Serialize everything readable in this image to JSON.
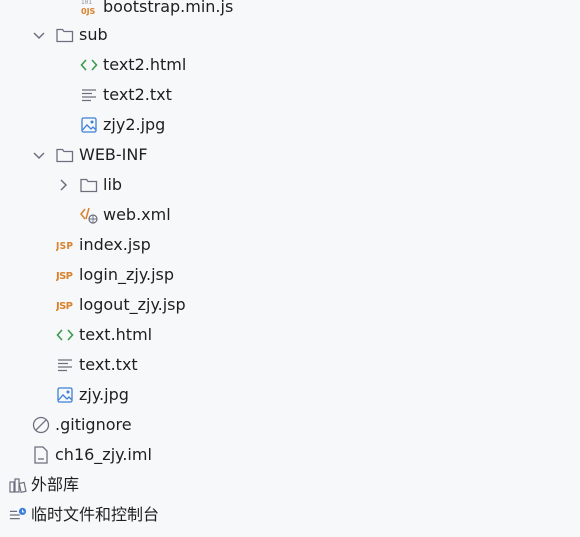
{
  "tree": {
    "items": [
      {
        "label": "bootstrap.min.js",
        "icon": "js-file-icon"
      },
      {
        "label": "sub",
        "icon": "folder-icon",
        "expanded": true
      },
      {
        "label": "text2.html",
        "icon": "html-file-icon"
      },
      {
        "label": "text2.txt",
        "icon": "text-file-icon"
      },
      {
        "label": "zjy2.jpg",
        "icon": "image-file-icon"
      },
      {
        "label": "WEB-INF",
        "icon": "folder-icon",
        "expanded": true
      },
      {
        "label": "lib",
        "icon": "folder-icon",
        "expanded": false
      },
      {
        "label": "web.xml",
        "icon": "xml-file-icon"
      },
      {
        "label": "index.jsp",
        "icon": "jsp-file-icon"
      },
      {
        "label": "login_zjy.jsp",
        "icon": "jsp-file-icon"
      },
      {
        "label": "logout_zjy.jsp",
        "icon": "jsp-file-icon"
      },
      {
        "label": "text.html",
        "icon": "html-file-icon"
      },
      {
        "label": "text.txt",
        "icon": "text-file-icon"
      },
      {
        "label": "zjy.jpg",
        "icon": "image-file-icon"
      },
      {
        "label": ".gitignore",
        "icon": "ignore-file-icon"
      },
      {
        "label": "ch16_zjy.iml",
        "icon": "module-file-icon"
      },
      {
        "label": "外部库",
        "icon": "library-icon"
      },
      {
        "label": "临时文件和控制台",
        "icon": "scratches-icon"
      }
    ]
  },
  "colors": {
    "background": "#f7f8fa",
    "html_icon": "#3a9b4d",
    "jsp_icon": "#d9822b",
    "image_icon": "#3d7fd8",
    "folder_outline": "#6c707e"
  }
}
